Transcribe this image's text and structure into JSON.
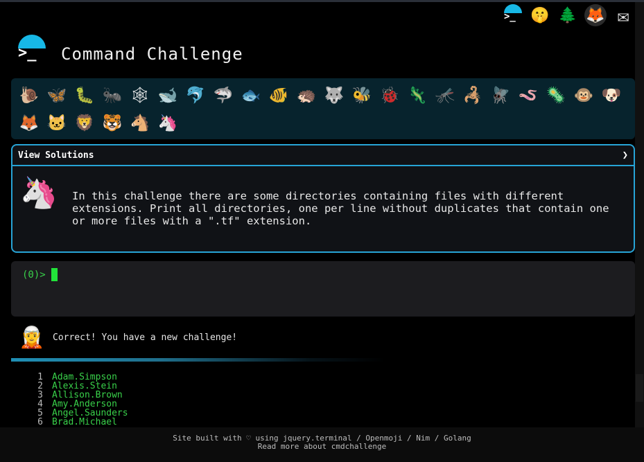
{
  "header": {
    "title": "Command Challenge",
    "logo_prompt": ">_",
    "top_icons": [
      {
        "name": "terminal-icon",
        "glyph": ">_"
      },
      {
        "name": "shushing-face-icon",
        "glyph": "🤫"
      },
      {
        "name": "tree-icon",
        "glyph": "🌲"
      },
      {
        "name": "gitlab-icon",
        "glyph": "🦊"
      },
      {
        "name": "mail-icon",
        "glyph": "✉"
      }
    ]
  },
  "animals": [
    {
      "name": "snail",
      "glyph": "🐌"
    },
    {
      "name": "butterfly",
      "glyph": "🦋"
    },
    {
      "name": "caterpillar",
      "glyph": "🐛"
    },
    {
      "name": "ant",
      "glyph": "🐜"
    },
    {
      "name": "spider-web",
      "glyph": "🕸"
    },
    {
      "name": "whale",
      "glyph": "🐋"
    },
    {
      "name": "dolphin",
      "glyph": "🐬"
    },
    {
      "name": "shark",
      "glyph": "🦈"
    },
    {
      "name": "fish",
      "glyph": "🐟"
    },
    {
      "name": "tropical-fish",
      "glyph": "🐠"
    },
    {
      "name": "hedgehog",
      "glyph": "🦔"
    },
    {
      "name": "wolf",
      "glyph": "🐺"
    },
    {
      "name": "bee",
      "glyph": "🐝"
    },
    {
      "name": "ladybug",
      "glyph": "🐞"
    },
    {
      "name": "lizard",
      "glyph": "🦎"
    },
    {
      "name": "mosquito",
      "glyph": "🦟"
    },
    {
      "name": "scorpion",
      "glyph": "🦂"
    },
    {
      "name": "fly",
      "glyph": "🪰"
    },
    {
      "name": "worm",
      "glyph": "🪱"
    },
    {
      "name": "microbe",
      "glyph": "🦠"
    },
    {
      "name": "monkey",
      "glyph": "🐵"
    },
    {
      "name": "dog",
      "glyph": "🐶"
    },
    {
      "name": "fox",
      "glyph": "🦊"
    },
    {
      "name": "cat",
      "glyph": "🐱"
    },
    {
      "name": "lion",
      "glyph": "🦁"
    },
    {
      "name": "tiger",
      "glyph": "🐯"
    },
    {
      "name": "horse",
      "glyph": "🐴"
    },
    {
      "name": "unicorn",
      "glyph": "🦄"
    }
  ],
  "solutions": {
    "header": "View Solutions",
    "arrow": "❯",
    "avatar_glyph": "🦄",
    "challenge_text": "In this challenge there are some directories containing files with different extensions. Print all directories, one per line without duplicates that contain one or more files with a \".tf\" extension."
  },
  "terminal": {
    "prompt": "(0)>"
  },
  "feedback": {
    "avatar_glyph": "🧝",
    "message": "Correct! You have a new challenge!"
  },
  "output": [
    {
      "num": "1",
      "name": "Adam.Simpson"
    },
    {
      "num": "2",
      "name": "Alexis.Stein"
    },
    {
      "num": "3",
      "name": "Allison.Brown"
    },
    {
      "num": "4",
      "name": "Amy.Anderson"
    },
    {
      "num": "5",
      "name": "Angel.Saunders"
    },
    {
      "num": "6",
      "name": "Brad.Michael"
    }
  ],
  "footer": {
    "line1": "Site built with ♡ using jquery.terminal / Openmoji / Nim / Golang",
    "line2": "Read more about cmdchallenge"
  },
  "colors": {
    "accent": "#27a4d6",
    "prompt_green": "#39d14a",
    "panel_bg": "#07232d"
  }
}
